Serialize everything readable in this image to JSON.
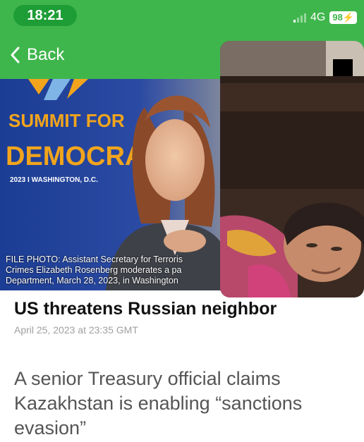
{
  "status_bar": {
    "time": "18:21",
    "network": "4G",
    "battery": "98"
  },
  "nav": {
    "back_label": "Back"
  },
  "photo": {
    "banner_line1": "SUMMIT FOR",
    "banner_line2": "DEMOCRACY",
    "banner_line3": "2023 I WASHINGTON, D.C.",
    "caption_lines": [
      "FILE PHOTO: Assistant Secretary for Terroris",
      "Crimes Elizabeth Rosenberg moderates a pa",
      "Department, March 28, 2023, in Washington"
    ]
  },
  "article": {
    "headline": "US threatens Russian neighbor",
    "timestamp": "April 25, 2023 at 23:35 GMT",
    "summary": "A senior Treasury official claims Kazakhstan is enabling “sanctions evasion”"
  },
  "colors": {
    "header_green": "#3fb64c",
    "time_pill": "#1e9d36",
    "banner_blue": "#1b3a8f",
    "banner_orange": "#f2a51c"
  }
}
